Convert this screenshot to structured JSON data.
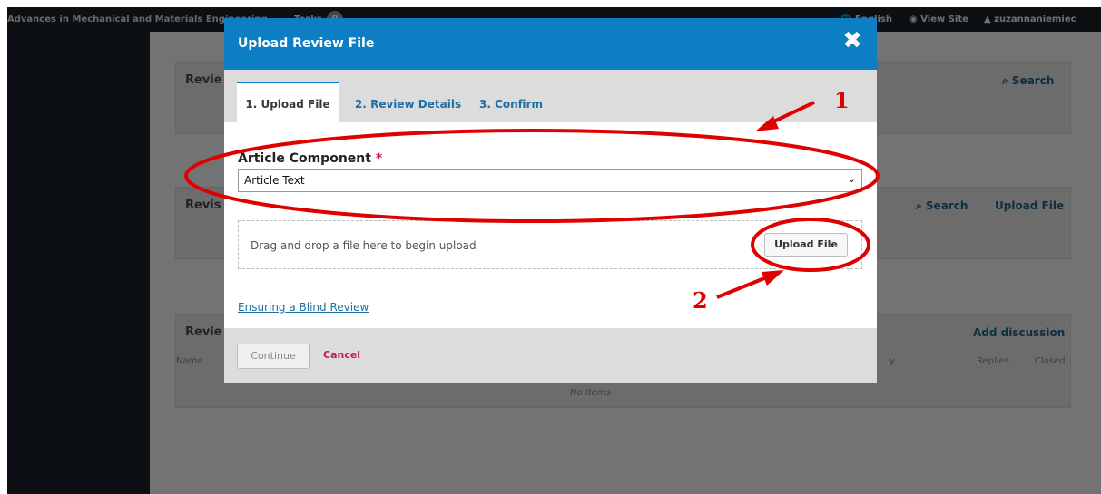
{
  "topbar": {
    "journal_title": "Advances in Mechanical and Materials Engineering",
    "tasks_label": "Tasks",
    "tasks_count": "0",
    "language": "English",
    "view_site": "View Site",
    "username": "zuzannaniemiec"
  },
  "background": {
    "panel1_title": "Revie",
    "panel1_search": "Search",
    "panel2_title": "Revis",
    "panel2_search": "Search",
    "panel2_upload": "Upload File",
    "panel3_title": "Revie",
    "panel3_add": "Add discussion",
    "col_name": "Name",
    "col_y": "y",
    "col_replies": "Replies",
    "col_closed": "Closed",
    "no_items": "No Items"
  },
  "modal": {
    "title": "Upload Review File",
    "close_glyph": "✖",
    "tabs": [
      "1. Upload File",
      "2. Review Details",
      "3. Confirm"
    ],
    "field_label": "Article Component",
    "required_mark": "*",
    "select_value": "Article Text",
    "drop_text": "Drag and drop a file here to begin upload",
    "upload_button": "Upload File",
    "blind_review_link": "Ensuring a Blind Review",
    "continue_button": "Continue",
    "cancel_link": "Cancel"
  },
  "annotations": {
    "label_1": "1",
    "label_2": "2",
    "color": "#e00000"
  },
  "colors": {
    "header_blue": "#0b7ec4",
    "link_blue": "#1e6fa3",
    "cancel_pink": "#c0195a"
  }
}
